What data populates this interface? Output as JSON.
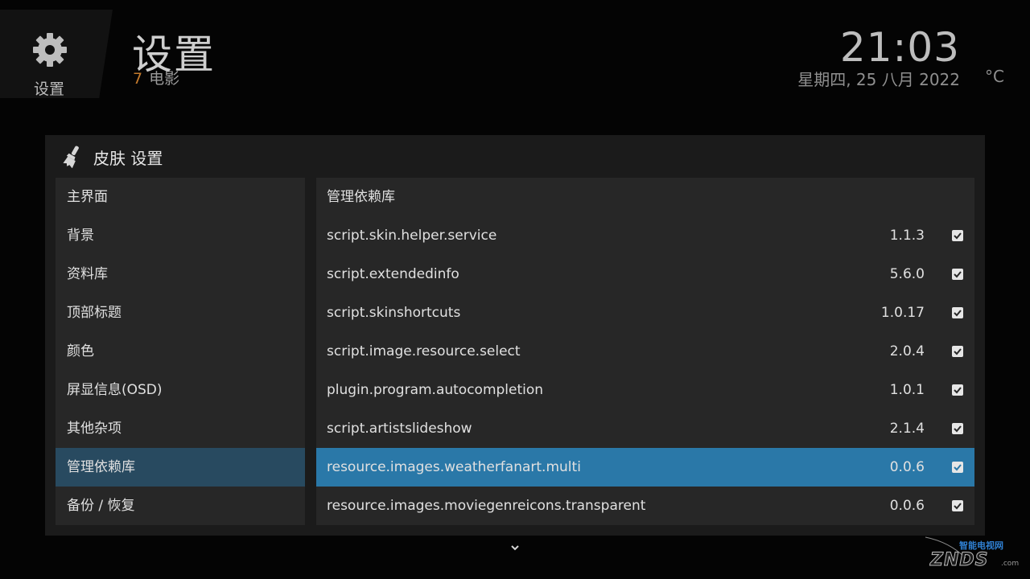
{
  "header": {
    "icon_label": "设置",
    "title": "设置",
    "subtitle_count": "7",
    "subtitle_text": "电影",
    "clock": "21:03",
    "date": "星期四, 25 八月 2022",
    "temperature": "°C"
  },
  "dialog": {
    "title": "皮肤 设置",
    "categories": [
      {
        "label": "主界面"
      },
      {
        "label": "背景"
      },
      {
        "label": "资料库"
      },
      {
        "label": "顶部标题"
      },
      {
        "label": "颜色"
      },
      {
        "label": "屏显信息(OSD)"
      },
      {
        "label": "其他杂项"
      },
      {
        "label": "管理依赖库"
      },
      {
        "label": "备份 / 恢复"
      }
    ],
    "active_category": "管理依赖库",
    "list_heading": "管理依赖库",
    "dependencies": [
      {
        "name": "script.skin.helper.service",
        "version": "1.1.3"
      },
      {
        "name": "script.extendedinfo",
        "version": "5.6.0"
      },
      {
        "name": "script.skinshortcuts",
        "version": "1.0.17"
      },
      {
        "name": "script.image.resource.select",
        "version": "2.0.4"
      },
      {
        "name": "plugin.program.autocompletion",
        "version": "1.0.1"
      },
      {
        "name": "script.artistslideshow",
        "version": "2.1.4"
      },
      {
        "name": "resource.images.weatherfanart.multi",
        "version": "0.0.6"
      },
      {
        "name": "resource.images.moviegenreicons.transparent",
        "version": "0.0.6"
      }
    ],
    "selected_dependency": "resource.images.weatherfanart.multi"
  },
  "watermark": {
    "logo": "ZNDS",
    "cn": "智能电视网",
    "suffix": ".com"
  },
  "colors": {
    "accent_selected": "#2a78a8",
    "category_selected": "#284a60",
    "subtitle_count": "#c47a2c"
  },
  "icons": [
    "gear-icon",
    "brush-icon",
    "checkbox-checked-icon",
    "chevron-down-icon"
  ]
}
